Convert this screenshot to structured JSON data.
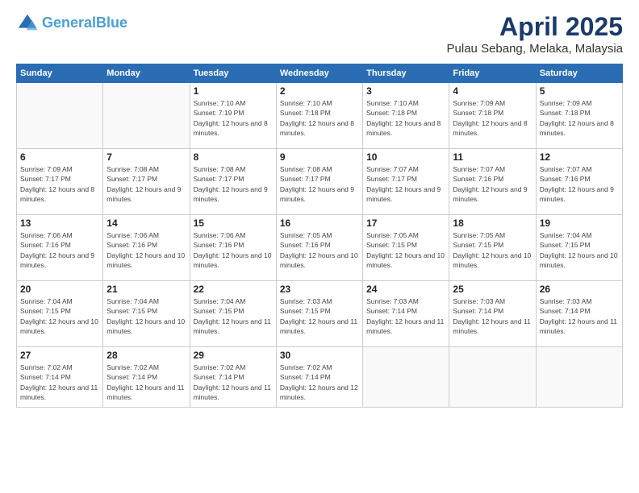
{
  "logo": {
    "line1": "General",
    "line2": "Blue"
  },
  "title": "April 2025",
  "location": "Pulau Sebang, Melaka, Malaysia",
  "days_of_week": [
    "Sunday",
    "Monday",
    "Tuesday",
    "Wednesday",
    "Thursday",
    "Friday",
    "Saturday"
  ],
  "weeks": [
    [
      {
        "day": "",
        "info": ""
      },
      {
        "day": "",
        "info": ""
      },
      {
        "day": "1",
        "info": "Sunrise: 7:10 AM\nSunset: 7:19 PM\nDaylight: 12 hours and 8 minutes."
      },
      {
        "day": "2",
        "info": "Sunrise: 7:10 AM\nSunset: 7:18 PM\nDaylight: 12 hours and 8 minutes."
      },
      {
        "day": "3",
        "info": "Sunrise: 7:10 AM\nSunset: 7:18 PM\nDaylight: 12 hours and 8 minutes."
      },
      {
        "day": "4",
        "info": "Sunrise: 7:09 AM\nSunset: 7:18 PM\nDaylight: 12 hours and 8 minutes."
      },
      {
        "day": "5",
        "info": "Sunrise: 7:09 AM\nSunset: 7:18 PM\nDaylight: 12 hours and 8 minutes."
      }
    ],
    [
      {
        "day": "6",
        "info": "Sunrise: 7:09 AM\nSunset: 7:17 PM\nDaylight: 12 hours and 8 minutes."
      },
      {
        "day": "7",
        "info": "Sunrise: 7:08 AM\nSunset: 7:17 PM\nDaylight: 12 hours and 9 minutes."
      },
      {
        "day": "8",
        "info": "Sunrise: 7:08 AM\nSunset: 7:17 PM\nDaylight: 12 hours and 9 minutes."
      },
      {
        "day": "9",
        "info": "Sunrise: 7:08 AM\nSunset: 7:17 PM\nDaylight: 12 hours and 9 minutes."
      },
      {
        "day": "10",
        "info": "Sunrise: 7:07 AM\nSunset: 7:17 PM\nDaylight: 12 hours and 9 minutes."
      },
      {
        "day": "11",
        "info": "Sunrise: 7:07 AM\nSunset: 7:16 PM\nDaylight: 12 hours and 9 minutes."
      },
      {
        "day": "12",
        "info": "Sunrise: 7:07 AM\nSunset: 7:16 PM\nDaylight: 12 hours and 9 minutes."
      }
    ],
    [
      {
        "day": "13",
        "info": "Sunrise: 7:06 AM\nSunset: 7:16 PM\nDaylight: 12 hours and 9 minutes."
      },
      {
        "day": "14",
        "info": "Sunrise: 7:06 AM\nSunset: 7:16 PM\nDaylight: 12 hours and 10 minutes."
      },
      {
        "day": "15",
        "info": "Sunrise: 7:06 AM\nSunset: 7:16 PM\nDaylight: 12 hours and 10 minutes."
      },
      {
        "day": "16",
        "info": "Sunrise: 7:05 AM\nSunset: 7:16 PM\nDaylight: 12 hours and 10 minutes."
      },
      {
        "day": "17",
        "info": "Sunrise: 7:05 AM\nSunset: 7:15 PM\nDaylight: 12 hours and 10 minutes."
      },
      {
        "day": "18",
        "info": "Sunrise: 7:05 AM\nSunset: 7:15 PM\nDaylight: 12 hours and 10 minutes."
      },
      {
        "day": "19",
        "info": "Sunrise: 7:04 AM\nSunset: 7:15 PM\nDaylight: 12 hours and 10 minutes."
      }
    ],
    [
      {
        "day": "20",
        "info": "Sunrise: 7:04 AM\nSunset: 7:15 PM\nDaylight: 12 hours and 10 minutes."
      },
      {
        "day": "21",
        "info": "Sunrise: 7:04 AM\nSunset: 7:15 PM\nDaylight: 12 hours and 10 minutes."
      },
      {
        "day": "22",
        "info": "Sunrise: 7:04 AM\nSunset: 7:15 PM\nDaylight: 12 hours and 11 minutes."
      },
      {
        "day": "23",
        "info": "Sunrise: 7:03 AM\nSunset: 7:15 PM\nDaylight: 12 hours and 11 minutes."
      },
      {
        "day": "24",
        "info": "Sunrise: 7:03 AM\nSunset: 7:14 PM\nDaylight: 12 hours and 11 minutes."
      },
      {
        "day": "25",
        "info": "Sunrise: 7:03 AM\nSunset: 7:14 PM\nDaylight: 12 hours and 11 minutes."
      },
      {
        "day": "26",
        "info": "Sunrise: 7:03 AM\nSunset: 7:14 PM\nDaylight: 12 hours and 11 minutes."
      }
    ],
    [
      {
        "day": "27",
        "info": "Sunrise: 7:02 AM\nSunset: 7:14 PM\nDaylight: 12 hours and 11 minutes."
      },
      {
        "day": "28",
        "info": "Sunrise: 7:02 AM\nSunset: 7:14 PM\nDaylight: 12 hours and 11 minutes."
      },
      {
        "day": "29",
        "info": "Sunrise: 7:02 AM\nSunset: 7:14 PM\nDaylight: 12 hours and 11 minutes."
      },
      {
        "day": "30",
        "info": "Sunrise: 7:02 AM\nSunset: 7:14 PM\nDaylight: 12 hours and 12 minutes."
      },
      {
        "day": "",
        "info": ""
      },
      {
        "day": "",
        "info": ""
      },
      {
        "day": "",
        "info": ""
      }
    ]
  ]
}
